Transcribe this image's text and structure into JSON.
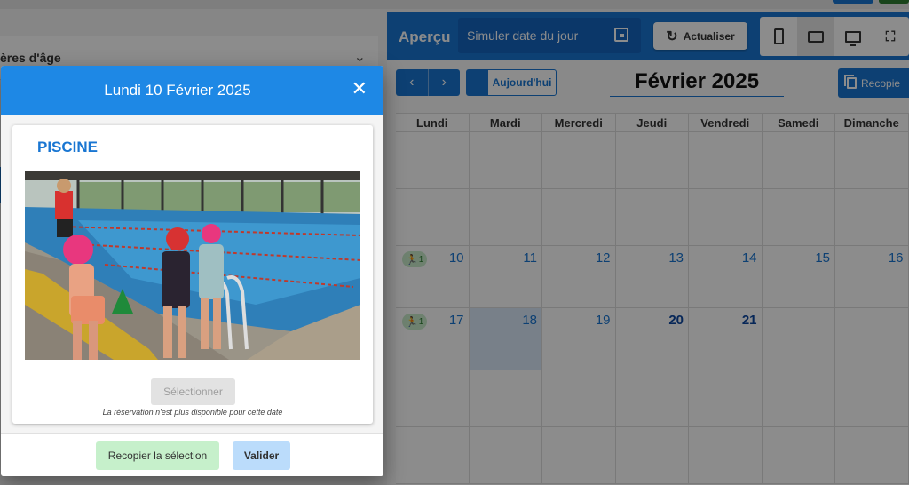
{
  "background": {
    "left": {
      "accordion_title": "ères d'âge"
    },
    "apercu": {
      "title": "Aperçu",
      "date_sim_placeholder": "Simuler date du jour",
      "refresh_label": "Actualiser"
    },
    "calendar": {
      "nav_prev": "‹",
      "nav_next": "›",
      "today_label": "Aujourd'hui",
      "month_title": "Février 2025",
      "copy_label": "Recopie",
      "weekdays": [
        "Lundi",
        "Mardi",
        "Mercredi",
        "Jeudi",
        "Vendredi",
        "Samedi",
        "Dimanche"
      ],
      "week3": [
        "10",
        "11",
        "12",
        "13",
        "14",
        "15",
        "16"
      ],
      "week4": [
        "17",
        "18",
        "19",
        "20",
        "21"
      ],
      "badge_count": "1"
    }
  },
  "modal": {
    "title": "Lundi 10 Février 2025",
    "card_title": "PISCINE",
    "select_label": "Sélectionner",
    "note": "La réservation n'est plus disponible pour cette date",
    "copy_selection_label": "Recopier la sélection",
    "validate_label": "Valider"
  },
  "colors": {
    "primary": "#1976d2",
    "header": "#1e88e5",
    "badge_bg": "#c8eccb",
    "recopier_bg": "#c6f0cb",
    "valider_bg": "#bbdcfb"
  }
}
